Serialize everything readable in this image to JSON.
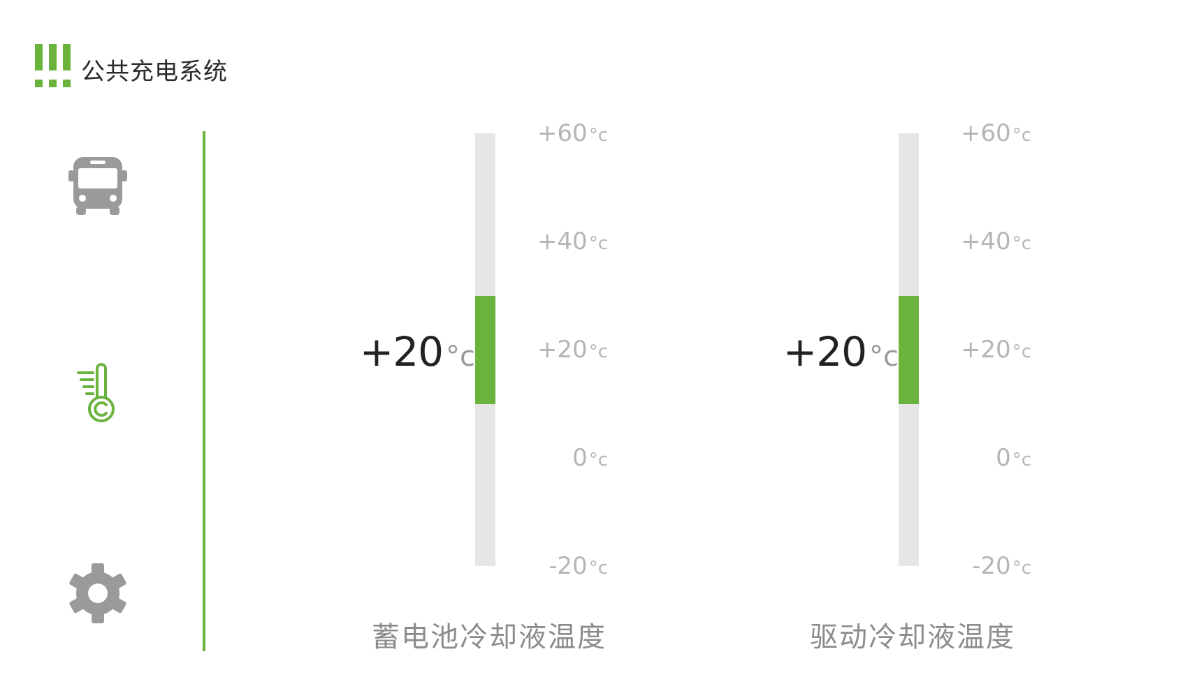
{
  "app": {
    "title": "公共充电系统",
    "accent_color": "#6ab43e"
  },
  "sidebar": {
    "items": [
      {
        "icon": "bus-icon",
        "active": false
      },
      {
        "icon": "thermometer-icon",
        "active": true
      },
      {
        "icon": "gear-icon",
        "active": false
      }
    ]
  },
  "gauges": [
    {
      "label": "蓄电池冷却液温度",
      "value": "+20",
      "unit": "°c",
      "range_min": -20,
      "range_max": 60,
      "fill_from": 10,
      "fill_to": 30,
      "ticks": [
        {
          "value": "+60",
          "unit": "°c"
        },
        {
          "value": "+40",
          "unit": "°c"
        },
        {
          "value": "+20",
          "unit": "°c"
        },
        {
          "value": "0",
          "unit": "°c"
        },
        {
          "value": "-20",
          "unit": "°c"
        }
      ]
    },
    {
      "label": "驱动冷却液温度",
      "value": "+20",
      "unit": "°c",
      "range_min": -20,
      "range_max": 60,
      "fill_from": 10,
      "fill_to": 30,
      "ticks": [
        {
          "value": "+60",
          "unit": "°c"
        },
        {
          "value": "+40",
          "unit": "°c"
        },
        {
          "value": "+20",
          "unit": "°c"
        },
        {
          "value": "0",
          "unit": "°c"
        },
        {
          "value": "-20",
          "unit": "°c"
        }
      ]
    }
  ]
}
